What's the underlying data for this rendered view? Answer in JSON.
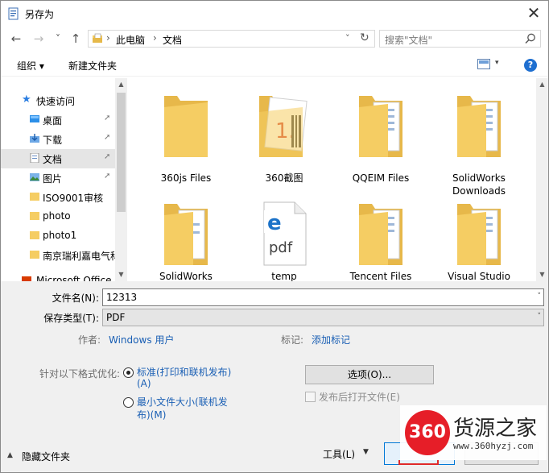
{
  "window": {
    "title": "另存为",
    "close_glyph": "✕"
  },
  "nav": {
    "back_glyph": "←",
    "forward_glyph": "→",
    "recent_glyph": "˅",
    "up_glyph": "↑",
    "breadcrumb": [
      "此电脑",
      "文档"
    ],
    "crumb_sep": "›",
    "dropdown_glyph": "˅",
    "refresh_glyph": "↻",
    "search_placeholder": "搜索\"文档\""
  },
  "toolbar": {
    "organize": "组织 ▾",
    "new_folder": "新建文件夹",
    "help": "?"
  },
  "sidebar": {
    "quick_access": "快速访问",
    "items": [
      {
        "label": "桌面",
        "pinned": true
      },
      {
        "label": "下载",
        "pinned": true
      },
      {
        "label": "文档",
        "pinned": true,
        "selected": true
      },
      {
        "label": "图片",
        "pinned": true
      },
      {
        "label": "ISO9001审核",
        "pinned": false
      },
      {
        "label": "photo",
        "pinned": false
      },
      {
        "label": "photo1",
        "pinned": false
      },
      {
        "label": "南京瑞利嘉电气科",
        "pinned": false
      },
      {
        "label": "Microsoft Office",
        "pinned": false
      }
    ],
    "pin_glyph": "📌"
  },
  "files": [
    {
      "name": "360js Files",
      "kind": "folder-empty"
    },
    {
      "name": "360截图",
      "kind": "folder-image"
    },
    {
      "name": "QQEIM Files",
      "kind": "folder-docs"
    },
    {
      "name": "SolidWorks Downloads",
      "kind": "folder-docs"
    },
    {
      "name": "SolidWorks",
      "kind": "folder-empty"
    },
    {
      "name": "temp",
      "kind": "pdf"
    },
    {
      "name": "Tencent Files",
      "kind": "folder-docs"
    },
    {
      "name": "Visual Studio",
      "kind": "folder-docs"
    }
  ],
  "form": {
    "filename_label": "文件名(N):",
    "filename_value": "12313",
    "filetype_label": "保存类型(T):",
    "filetype_value": "PDF",
    "author_label": "作者:",
    "author_value": "Windows 用户",
    "tags_label": "标记:",
    "tags_value": "添加标记",
    "optimize_label": "针对以下格式优化:",
    "option_standard_line1": "标准(打印和联机发布)",
    "option_standard_line2": "(A)",
    "option_min_line1": "最小文件大小(联机发",
    "option_min_line2": "布)(M)",
    "options_button": "选项(O)...",
    "open_after": "发布后打开文件(E)"
  },
  "footer": {
    "hide_folders": "隐藏文件夹",
    "tools": "工具(L)",
    "tools_arrow": "▼"
  },
  "watermark": {
    "logo_text": "360",
    "brand": "货源之家",
    "url": "www.360hyzj.com"
  },
  "colors": {
    "accent": "#1a5fb4",
    "folder": "#f5cd63",
    "logo_red": "#e61e28"
  }
}
